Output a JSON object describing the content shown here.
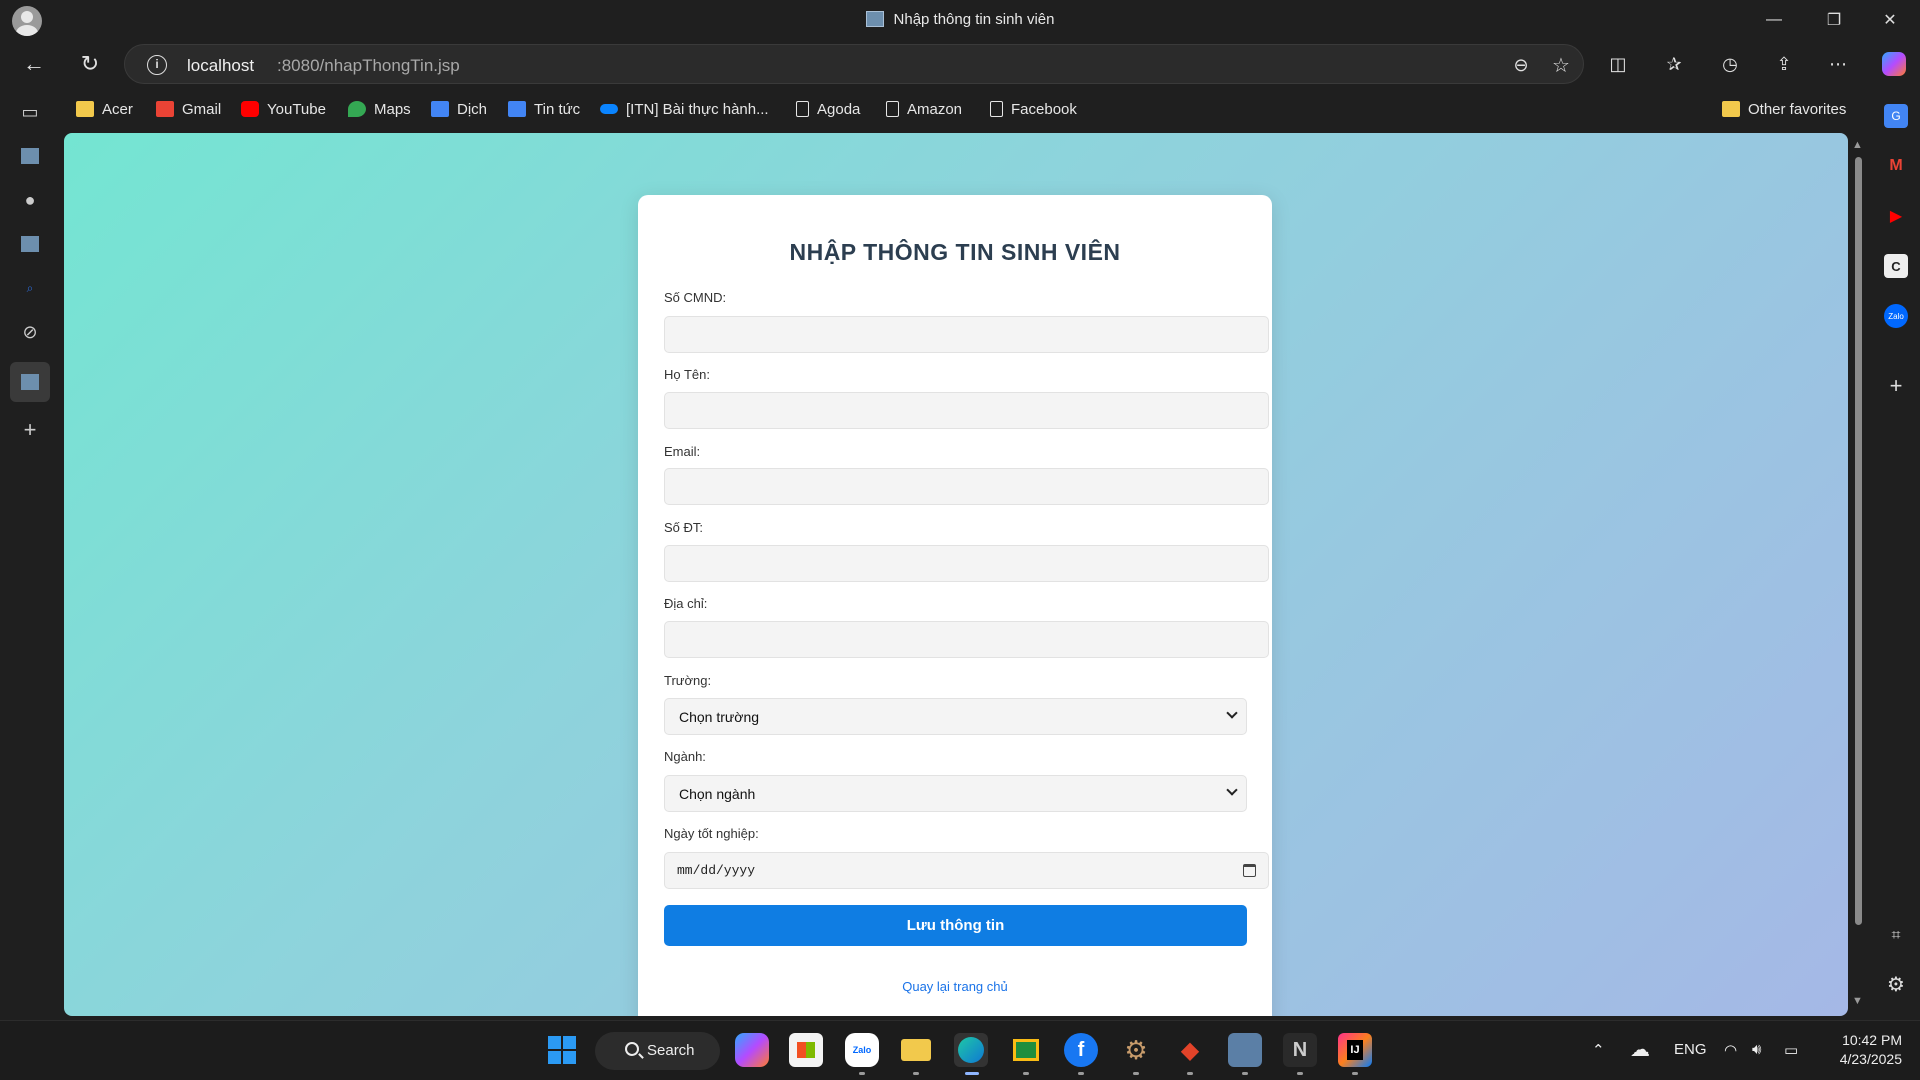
{
  "window": {
    "tab_title": "Nhập thông tin sinh viên",
    "minimize": "—",
    "restore": "❐",
    "close": "✕"
  },
  "address_bar": {
    "host": "localhost",
    "path": ":8080/nhapThongTin.jsp",
    "info_glyph": "i"
  },
  "bookmarks": [
    {
      "label": "Acer",
      "icon": "folder-icon",
      "color": "#f2c94c"
    },
    {
      "label": "Gmail",
      "icon": "gmail-icon",
      "color": "#ea4335"
    },
    {
      "label": "YouTube",
      "icon": "youtube-icon",
      "color": "#ff0000"
    },
    {
      "label": "Maps",
      "icon": "maps-icon",
      "color": "#34a853"
    },
    {
      "label": "Dịch",
      "icon": "translate-icon",
      "color": "#4285f4"
    },
    {
      "label": "Tin tức",
      "icon": "news-icon",
      "color": "#4285f4"
    },
    {
      "label": "[ITN] Bài thực hành...",
      "icon": "onedrive-icon",
      "color": "#0a84ff"
    },
    {
      "label": "Agoda",
      "icon": "page-icon",
      "color": "#e6e6e6"
    },
    {
      "label": "Amazon",
      "icon": "page-icon",
      "color": "#e6e6e6"
    },
    {
      "label": "Facebook",
      "icon": "page-icon",
      "color": "#e6e6e6"
    },
    {
      "label": "Other favorites",
      "icon": "folder-icon",
      "color": "#f2c94c"
    }
  ],
  "form": {
    "title": "NHẬP THÔNG TIN SINH VIÊN",
    "fields": [
      {
        "label": "Số CMND:",
        "value": ""
      },
      {
        "label": "Họ Tên:",
        "value": ""
      },
      {
        "label": "Email:",
        "value": ""
      },
      {
        "label": "Số ĐT:",
        "value": ""
      },
      {
        "label": "Địa chỉ:",
        "value": ""
      }
    ],
    "truong": {
      "label": "Trường:",
      "selected": "Chọn trường"
    },
    "nganh": {
      "label": "Ngành:",
      "selected": "Chọn ngành"
    },
    "ngay": {
      "label": "Ngày tốt nghiệp:",
      "placeholder": "mm/dd/yyyy"
    },
    "submit": "Lưu thông tin",
    "back": "Quay lại trang chủ"
  },
  "taskbar": {
    "search": "Search",
    "lang": "ENG",
    "time": "10:42 PM",
    "date": "4/23/2025"
  },
  "colors": {
    "accent": "#0f7de3",
    "title": "#2c3e50",
    "link": "#1a73e8"
  }
}
